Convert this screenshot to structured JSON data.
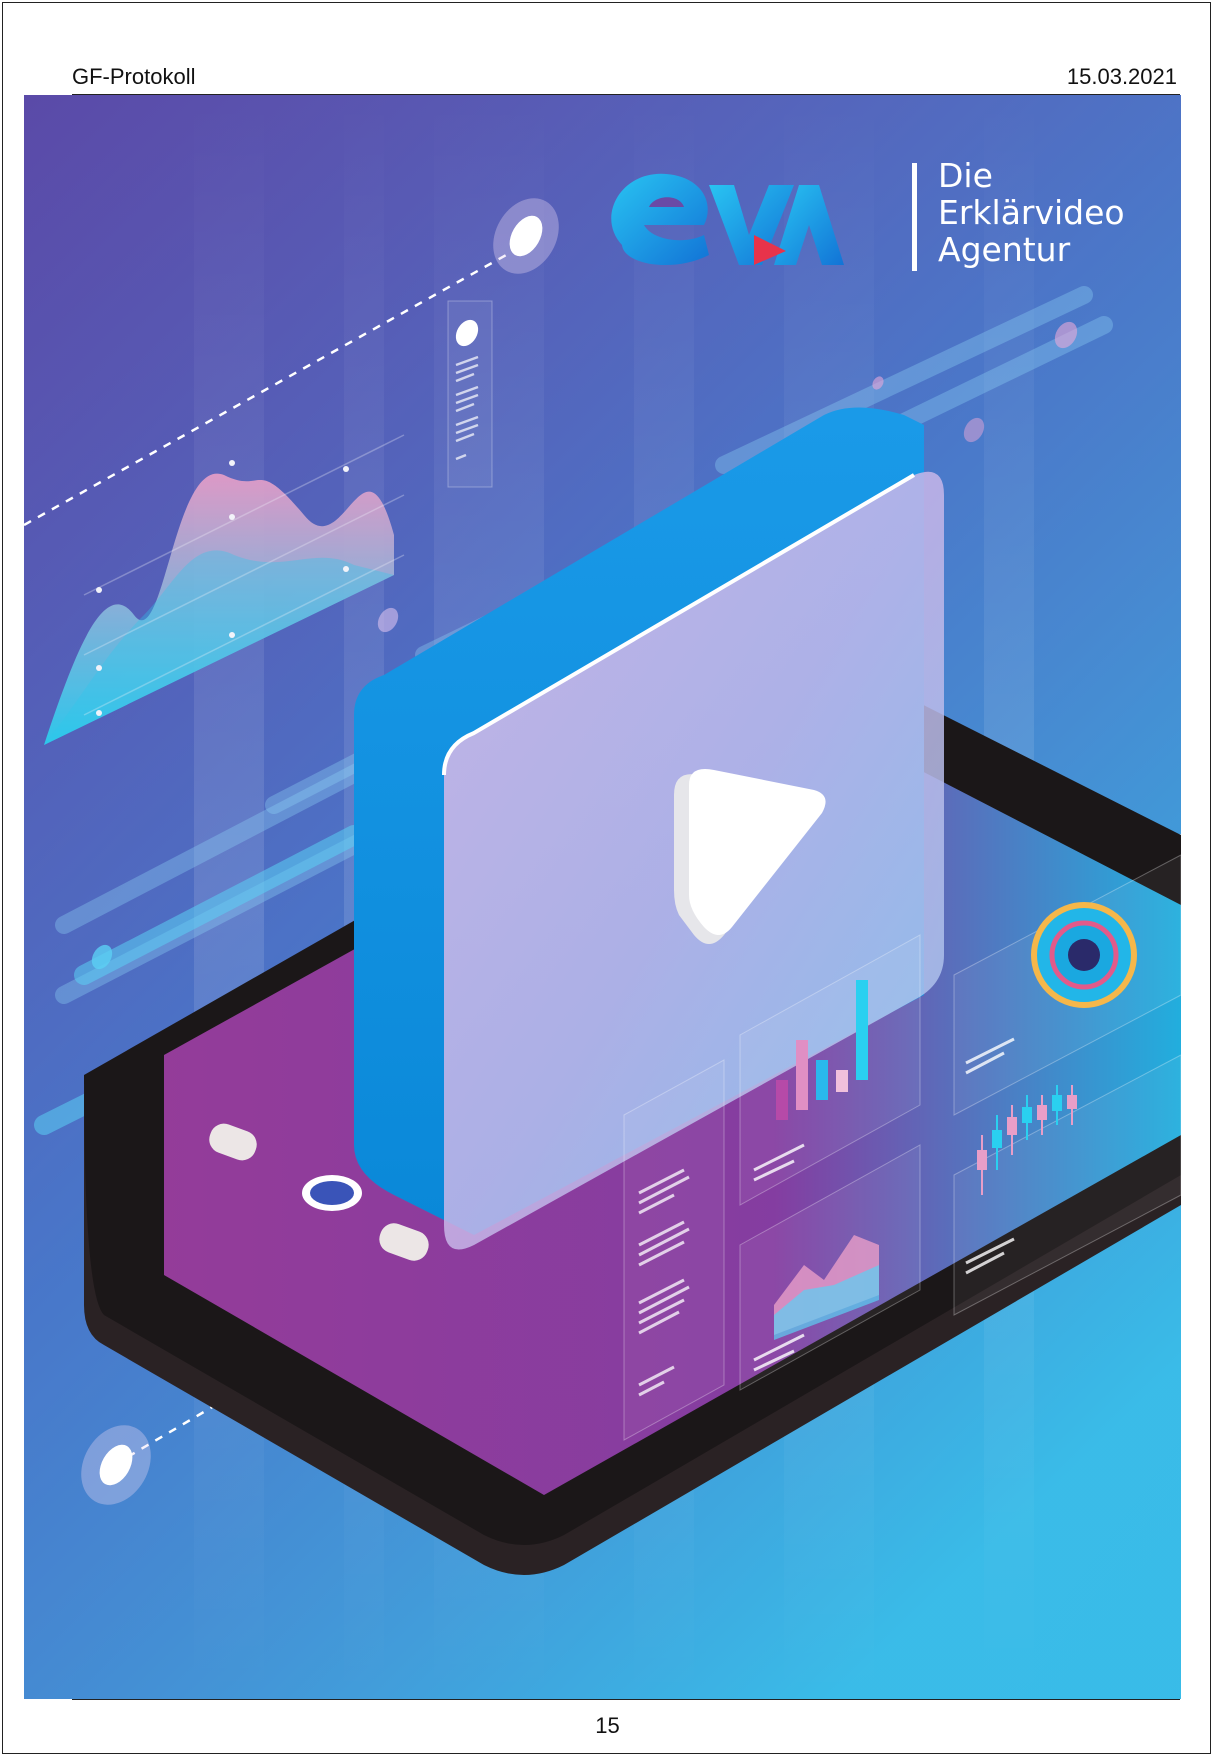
{
  "header": {
    "left": "GF-Protokoll",
    "right": "15.03.2021"
  },
  "logo": {
    "mark": "eVA",
    "lines": [
      "Die",
      "Erklärvideo",
      "Agentur"
    ]
  },
  "illustration": {
    "icons": [
      "play-button-icon",
      "smartphone",
      "wave-chart",
      "bar-chart",
      "donut-chart",
      "candlestick-chart"
    ]
  },
  "colors": {
    "purple": "#6a4aa6",
    "magenta": "#a34b9c",
    "blue": "#2f7fd6",
    "cyan": "#2ad0f0",
    "pink": "#e89ec8",
    "phone_dark": "#1b1718"
  },
  "footer": {
    "page_number": "15"
  }
}
